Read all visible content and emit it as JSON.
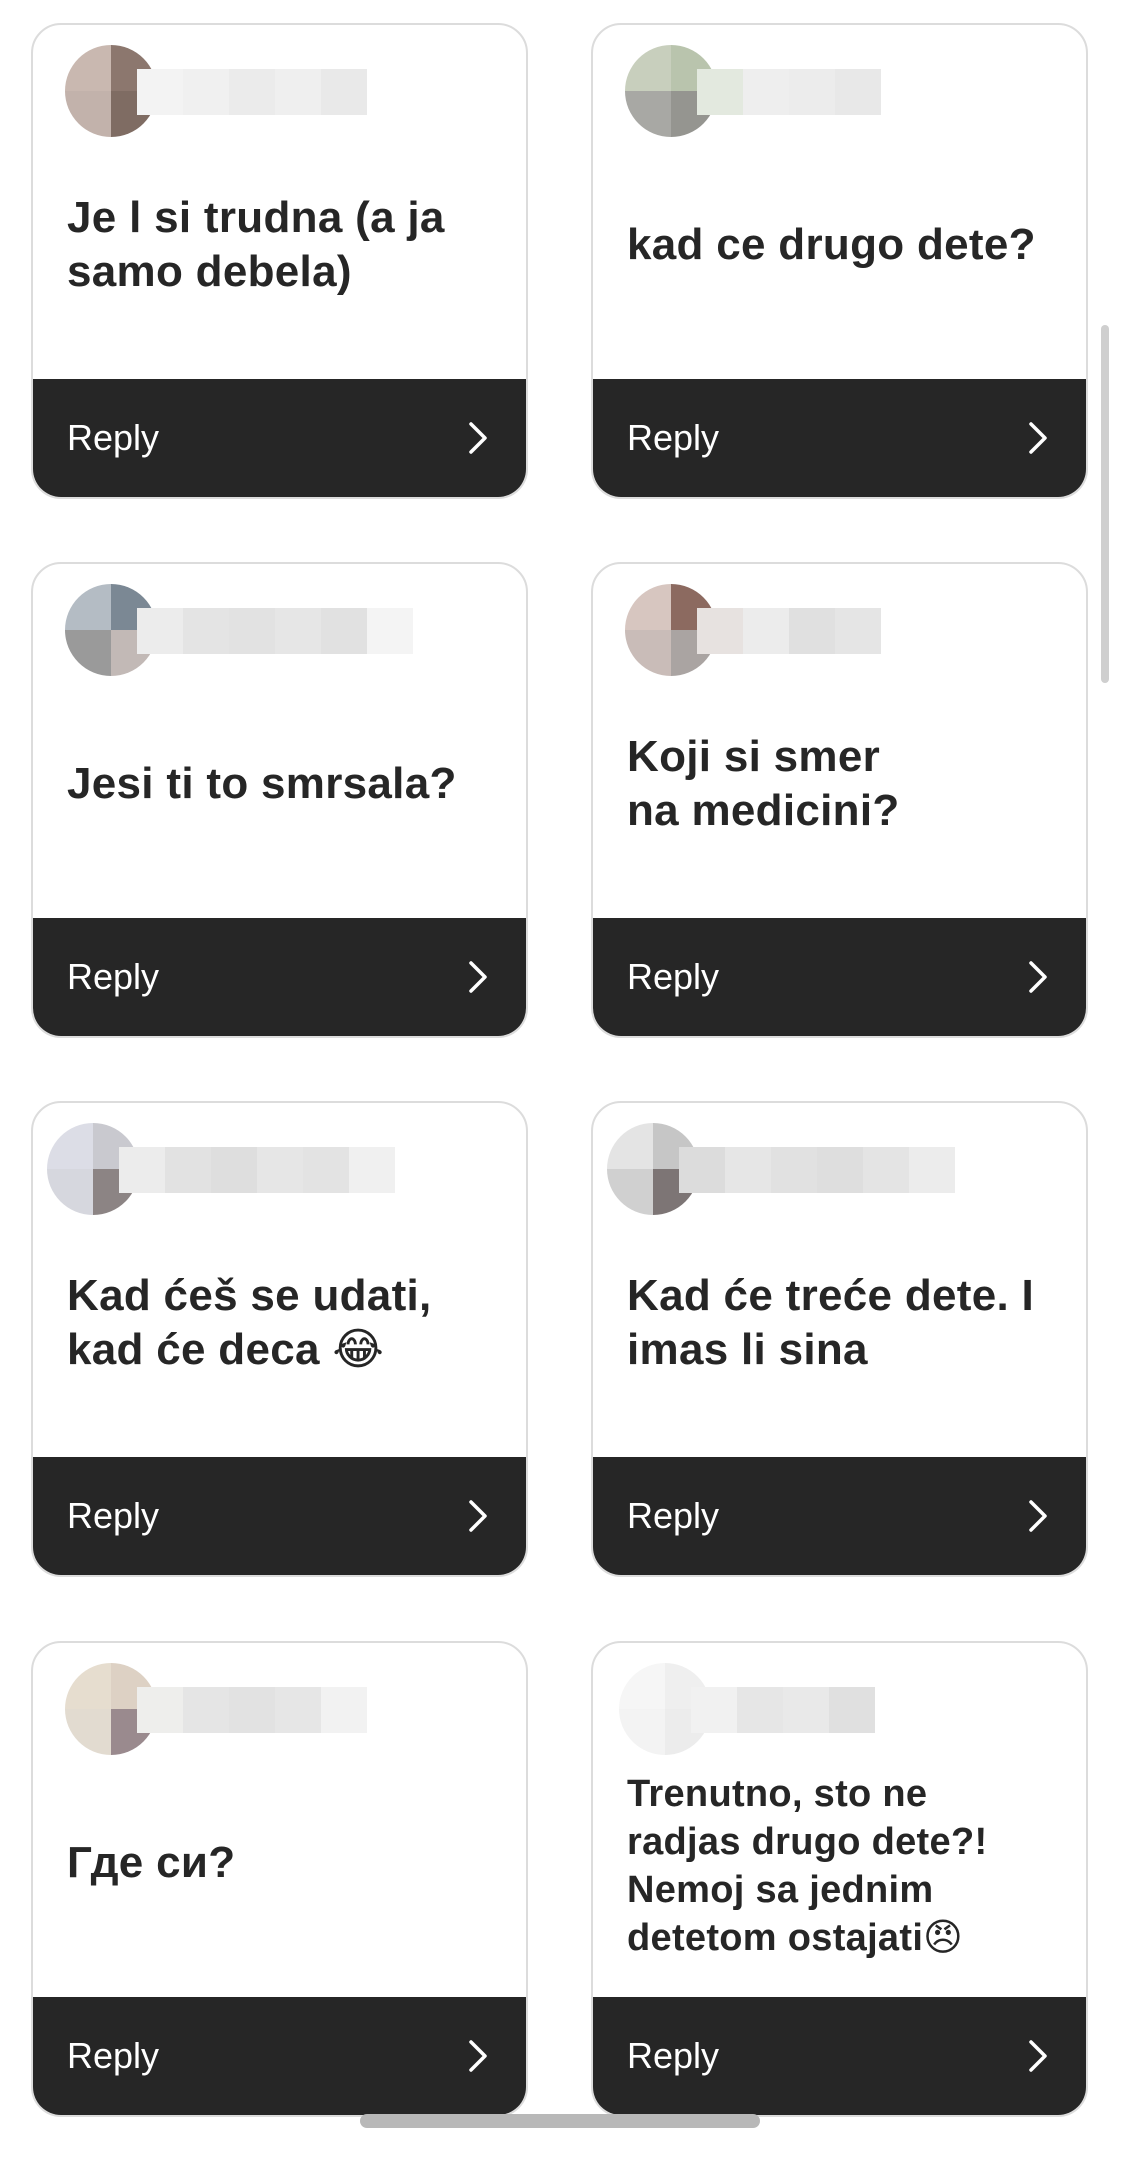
{
  "reply_label": "Reply",
  "cards": [
    {
      "message": "Je l si trudna (a ja\nsamo debela)"
    },
    {
      "message": "kad ce drugo dete?"
    },
    {
      "message": "Jesi ti to smrsala?"
    },
    {
      "message": "Koji si smer\nna medicini?"
    },
    {
      "message": "Kad ćeš se udati,\nkad će deca 😂"
    },
    {
      "message": "Kad će treće dete. I\nimas li sina"
    },
    {
      "message": "Где си?"
    },
    {
      "message": "Trenutno, sto ne\nradjas drugo dete?!\nNemoj sa jednim\ndetetom ostajati😠"
    }
  ],
  "colors": {
    "reply_bar": "#262626",
    "message_text": "#262626",
    "card_border": "#dcdcdc"
  },
  "icons": {
    "reply_arrow": "chevron-right-icon",
    "avatar": "blurred-avatar",
    "name": "blurred-username"
  }
}
